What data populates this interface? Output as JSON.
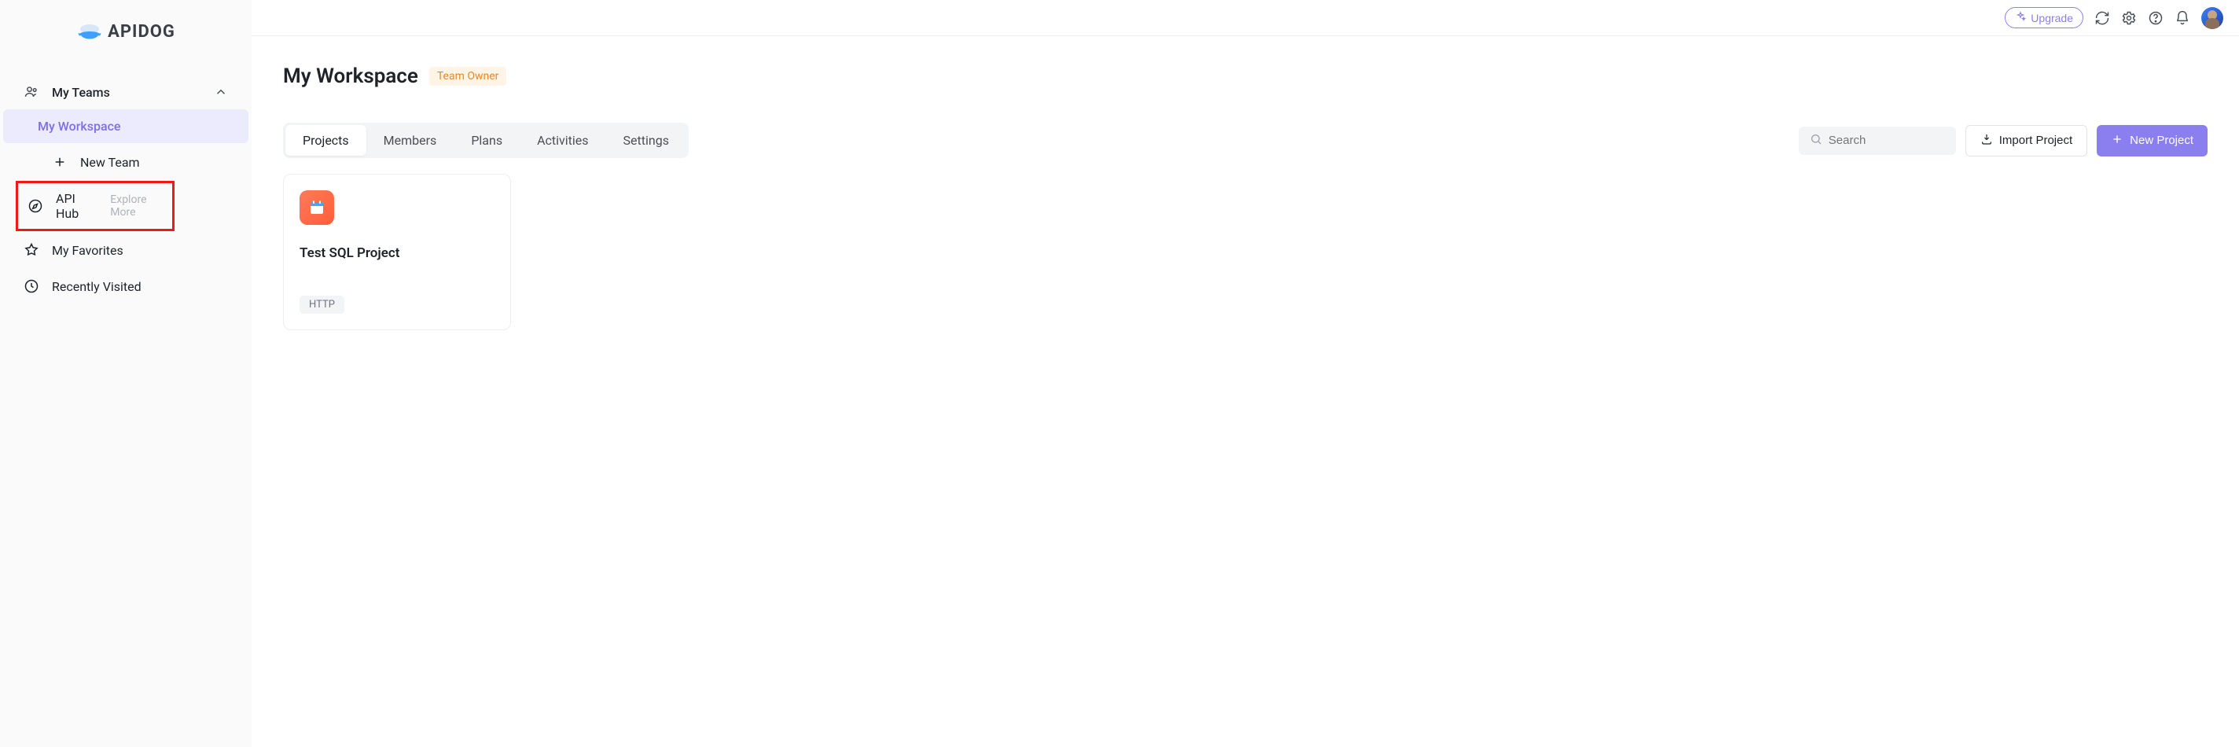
{
  "brand": "APIDOG",
  "sidebar": {
    "teams_label": "My Teams",
    "workspace_label": "My Workspace",
    "new_team_label": "New Team",
    "api_hub_label": "API Hub",
    "api_hub_hint": "Explore More",
    "favorites_label": "My Favorites",
    "recent_label": "Recently Visited"
  },
  "topbar": {
    "upgrade_label": "Upgrade"
  },
  "page": {
    "title": "My Workspace",
    "owner_badge": "Team Owner"
  },
  "tabs": [
    "Projects",
    "Members",
    "Plans",
    "Activities",
    "Settings"
  ],
  "search": {
    "placeholder": "Search"
  },
  "actions": {
    "import_label": "Import Project",
    "new_label": "New Project"
  },
  "projects": [
    {
      "name": "Test SQL Project",
      "type": "HTTP"
    }
  ]
}
